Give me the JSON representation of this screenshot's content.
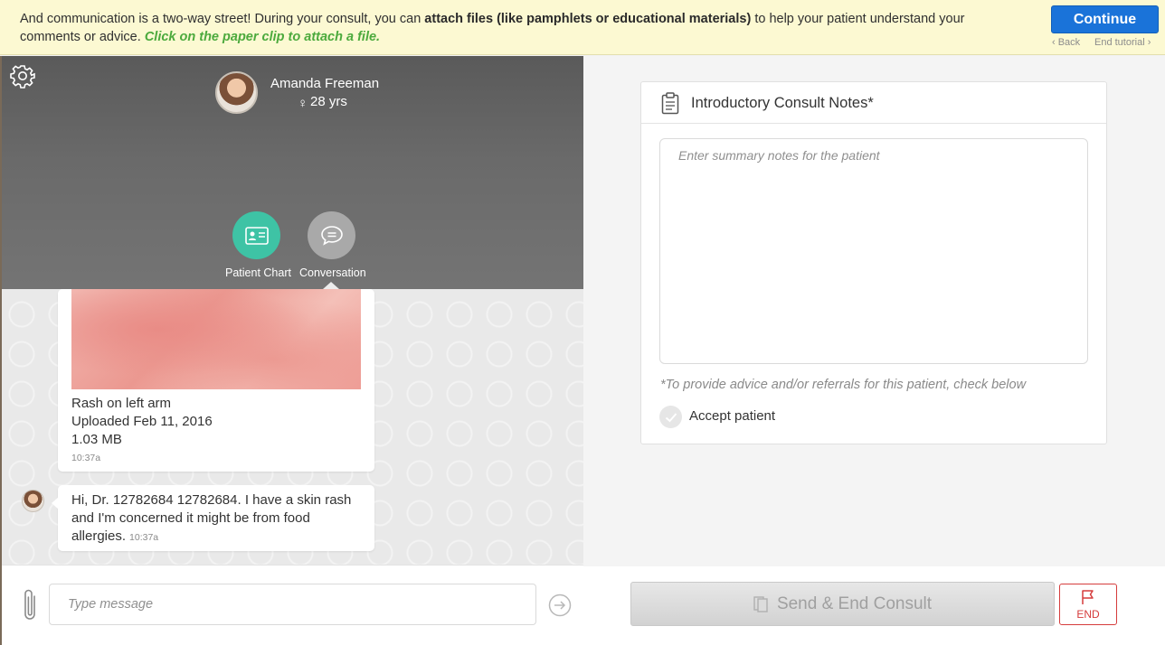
{
  "banner": {
    "text_before": "And communication is a two-way street! During your consult, you can ",
    "text_bold": "attach files (like pamphlets or educational materials)",
    "text_after": " to help your patient understand your comments or advice. ",
    "text_highlight": "Click on the paper clip to attach a file.",
    "continue_label": "Continue",
    "back_label": "‹ Back",
    "end_tutorial_label": "End tutorial ›",
    "bg_color": "#fcf9d2",
    "continue_color": "#1a73d9",
    "highlight_color": "#4caa3d"
  },
  "patient": {
    "name": "Amanda Freeman",
    "gender_symbol": "♀",
    "age": "28 yrs"
  },
  "nav": {
    "chart_label": "Patient Chart",
    "conversation_label": "Conversation",
    "chart_color": "#3ec3a5"
  },
  "messages": {
    "image_card": {
      "caption": "Rash on left arm",
      "uploaded": "Uploaded Feb 11, 2016",
      "size": "1.03 MB",
      "time": "10:37a"
    },
    "patient_message": {
      "text": "Hi, Dr. 12782684 12782684. I have a skin rash and I'm concerned it might be from food allergies.",
      "time": "10:37a"
    }
  },
  "composer": {
    "placeholder": "Type message"
  },
  "notes": {
    "title": "Introductory Consult Notes*",
    "placeholder": "Enter summary notes for the patient",
    "advice_note": "*To provide advice and/or referrals for this patient, check below",
    "accept_label": "Accept patient"
  },
  "footer": {
    "send_end_label": "Send & End Consult",
    "end_label": "END",
    "end_color": "#d53c3c"
  }
}
